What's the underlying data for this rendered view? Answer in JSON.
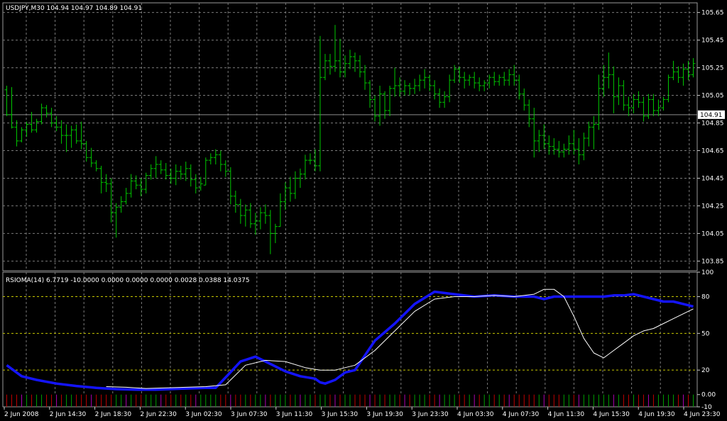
{
  "chart_data": [
    {
      "type": "ohlc",
      "title": "USDJPY,M30  104.94 104.97 104.89 104.91",
      "colors": {
        "bars": "#00c800",
        "background": "#000000",
        "grid": "#7a7a7a",
        "current_price_line": "#8c8c8c"
      },
      "ylim": [
        103.78,
        105.72
      ],
      "ytick_labels": [
        "105.65",
        "105.45",
        "105.25",
        "105.05",
        "104.85",
        "104.65",
        "104.45",
        "104.25",
        "104.05",
        "103.85"
      ],
      "current_price": 104.91,
      "current_price_label": "104.91",
      "grid": true,
      "bars": [
        [
          0,
          105.09,
          105.12,
          104.9,
          104.91
        ],
        [
          1,
          104.91,
          105.11,
          104.81,
          104.82
        ],
        [
          2,
          104.82,
          104.87,
          104.68,
          104.72
        ],
        [
          3,
          104.72,
          104.82,
          104.71,
          104.8
        ],
        [
          4,
          104.8,
          104.86,
          104.75,
          104.84
        ],
        [
          5,
          104.84,
          104.93,
          104.78,
          104.8
        ],
        [
          6,
          104.8,
          104.88,
          104.78,
          104.86
        ],
        [
          7,
          104.86,
          104.99,
          104.84,
          104.96
        ],
        [
          8,
          104.96,
          104.98,
          104.89,
          104.92
        ],
        [
          9,
          104.92,
          104.96,
          104.82,
          104.85
        ],
        [
          10,
          104.85,
          104.9,
          104.79,
          104.82
        ],
        [
          11,
          104.82,
          104.87,
          104.7,
          104.76
        ],
        [
          12,
          104.76,
          104.84,
          104.64,
          104.76
        ],
        [
          13,
          104.76,
          104.83,
          104.67,
          104.8
        ],
        [
          14,
          104.8,
          104.84,
          104.7,
          104.72
        ],
        [
          15,
          104.72,
          104.86,
          104.66,
          104.7
        ],
        [
          16,
          104.7,
          104.72,
          104.57,
          104.6
        ],
        [
          17,
          104.6,
          104.67,
          104.53,
          104.56
        ],
        [
          18,
          104.56,
          104.58,
          104.5,
          104.52
        ],
        [
          19,
          104.52,
          104.54,
          104.34,
          104.42
        ],
        [
          20,
          104.42,
          104.48,
          104.35,
          104.41
        ],
        [
          21,
          104.41,
          104.45,
          104.13,
          104.2
        ],
        [
          22,
          104.2,
          104.27,
          104.02,
          104.24
        ],
        [
          23,
          104.24,
          104.32,
          104.2,
          104.28
        ],
        [
          24,
          104.28,
          104.38,
          104.26,
          104.34
        ],
        [
          25,
          104.34,
          104.48,
          104.31,
          104.43
        ],
        [
          26,
          104.43,
          104.47,
          104.37,
          104.4
        ],
        [
          27,
          104.4,
          104.45,
          104.32,
          104.37
        ],
        [
          28,
          104.37,
          104.49,
          104.34,
          104.47
        ],
        [
          29,
          104.47,
          104.55,
          104.44,
          104.52
        ],
        [
          30,
          104.52,
          104.61,
          104.45,
          104.55
        ],
        [
          31,
          104.55,
          104.58,
          104.48,
          104.51
        ],
        [
          32,
          104.51,
          104.56,
          104.44,
          104.47
        ],
        [
          33,
          104.47,
          104.52,
          104.41,
          104.45
        ],
        [
          34,
          104.45,
          104.55,
          104.4,
          104.5
        ],
        [
          35,
          104.5,
          104.54,
          104.44,
          104.48
        ],
        [
          36,
          104.48,
          104.57,
          104.43,
          104.52
        ],
        [
          37,
          104.52,
          104.55,
          104.39,
          104.44
        ],
        [
          38,
          104.44,
          104.48,
          104.34,
          104.38
        ],
        [
          39,
          104.38,
          104.46,
          104.36,
          104.41
        ],
        [
          40,
          104.4,
          104.6,
          104.4,
          104.58
        ],
        [
          41,
          104.58,
          104.63,
          104.55,
          104.6
        ],
        [
          42,
          104.6,
          104.66,
          104.55,
          104.62
        ],
        [
          43,
          104.62,
          104.65,
          104.5,
          104.55
        ],
        [
          44,
          104.55,
          104.58,
          104.46,
          104.5
        ],
        [
          45,
          104.5,
          104.53,
          104.26,
          104.32
        ],
        [
          46,
          104.32,
          104.36,
          104.2,
          104.26
        ],
        [
          47,
          104.26,
          104.3,
          104.12,
          104.18
        ],
        [
          48,
          104.18,
          104.26,
          104.1,
          104.22
        ],
        [
          49,
          104.22,
          104.27,
          104.09,
          104.12
        ],
        [
          50,
          104.12,
          104.2,
          104.04,
          104.14
        ],
        [
          51,
          104.14,
          104.24,
          104.08,
          104.2
        ],
        [
          52,
          104.2,
          104.26,
          104.12,
          104.18
        ],
        [
          53,
          104.18,
          104.22,
          103.9,
          104.05
        ],
        [
          54,
          104.05,
          104.12,
          103.98,
          104.1
        ],
        [
          55,
          104.1,
          104.34,
          104.1,
          104.28
        ],
        [
          56,
          104.28,
          104.42,
          104.22,
          104.38
        ],
        [
          57,
          104.38,
          104.46,
          104.28,
          104.34
        ],
        [
          58,
          104.34,
          104.5,
          104.3,
          104.45
        ],
        [
          59,
          104.45,
          104.52,
          104.38,
          104.48
        ],
        [
          60,
          104.48,
          104.62,
          104.44,
          104.58
        ],
        [
          61,
          104.58,
          104.63,
          104.55,
          104.58
        ],
        [
          62,
          104.58,
          104.66,
          104.5,
          104.54
        ],
        [
          63,
          104.54,
          105.48,
          104.5,
          105.18
        ],
        [
          64,
          105.18,
          105.35,
          105.16,
          105.3
        ],
        [
          65,
          105.3,
          105.35,
          105.2,
          105.26
        ],
        [
          66,
          105.26,
          105.56,
          105.22,
          105.3
        ],
        [
          67,
          105.3,
          105.46,
          105.18,
          105.22
        ],
        [
          68,
          105.22,
          105.34,
          105.18,
          105.28
        ],
        [
          69,
          105.28,
          105.38,
          105.24,
          105.33
        ],
        [
          70,
          105.33,
          105.36,
          105.22,
          105.3
        ],
        [
          71,
          105.3,
          105.34,
          105.18,
          105.22
        ],
        [
          72,
          105.22,
          105.27,
          105.09,
          105.14
        ],
        [
          73,
          105.14,
          105.16,
          104.96,
          105.02
        ],
        [
          74,
          105.02,
          105.05,
          104.86,
          104.9
        ],
        [
          75,
          104.9,
          105.12,
          104.83,
          105.06
        ],
        [
          76,
          105.06,
          105.08,
          104.88,
          104.94
        ],
        [
          77,
          104.94,
          105.12,
          104.9,
          105.1
        ],
        [
          78,
          105.1,
          105.25,
          105.04,
          105.12
        ],
        [
          79,
          105.12,
          105.18,
          105.04,
          105.08
        ],
        [
          80,
          105.08,
          105.16,
          105.05,
          105.12
        ],
        [
          81,
          105.12,
          105.14,
          105.05,
          105.1
        ],
        [
          82,
          105.1,
          105.17,
          105.06,
          105.12
        ],
        [
          83,
          105.12,
          105.2,
          105.08,
          105.16
        ],
        [
          84,
          105.16,
          105.24,
          105.1,
          105.18
        ],
        [
          85,
          105.18,
          105.2,
          105.08,
          105.12
        ],
        [
          86,
          105.12,
          105.16,
          105.02,
          105.06
        ],
        [
          87,
          105.06,
          105.1,
          104.96,
          105.0
        ],
        [
          88,
          105.0,
          105.08,
          104.96,
          105.04
        ],
        [
          89,
          105.04,
          105.2,
          105.0,
          105.16
        ],
        [
          90,
          105.16,
          105.27,
          105.14,
          105.24
        ],
        [
          91,
          105.24,
          105.26,
          105.14,
          105.18
        ],
        [
          92,
          105.18,
          105.22,
          105.1,
          105.16
        ],
        [
          93,
          105.16,
          105.2,
          105.12,
          105.18
        ],
        [
          94,
          105.18,
          105.22,
          105.1,
          105.14
        ],
        [
          95,
          105.14,
          105.18,
          105.08,
          105.12
        ],
        [
          96,
          105.12,
          105.16,
          105.08,
          105.14
        ],
        [
          97,
          105.14,
          105.2,
          105.1,
          105.18
        ],
        [
          98,
          105.18,
          105.22,
          105.12,
          105.15
        ],
        [
          99,
          105.15,
          105.2,
          105.12,
          105.18
        ],
        [
          100,
          105.18,
          105.22,
          105.12,
          105.16
        ],
        [
          101,
          105.16,
          105.24,
          105.12,
          105.2
        ],
        [
          102,
          105.2,
          105.27,
          105.12,
          105.16
        ],
        [
          103,
          105.16,
          105.2,
          105.02,
          105.06
        ],
        [
          104,
          105.06,
          105.1,
          104.94,
          104.98
        ],
        [
          105,
          104.98,
          105.02,
          104.82,
          104.88
        ],
        [
          106,
          104.88,
          104.96,
          104.6,
          104.72
        ],
        [
          107,
          104.72,
          104.8,
          104.64,
          104.76
        ],
        [
          108,
          104.76,
          104.84,
          104.66,
          104.7
        ],
        [
          109,
          104.7,
          104.76,
          104.62,
          104.68
        ],
        [
          110,
          104.68,
          104.74,
          104.62,
          104.66
        ],
        [
          111,
          104.66,
          104.72,
          104.6,
          104.64
        ],
        [
          112,
          104.64,
          104.7,
          104.6,
          104.66
        ],
        [
          113,
          104.66,
          104.76,
          104.62,
          104.7
        ],
        [
          114,
          104.7,
          104.8,
          104.62,
          104.66
        ],
        [
          115,
          104.66,
          104.74,
          104.55,
          104.62
        ],
        [
          116,
          104.62,
          104.78,
          104.58,
          104.74
        ],
        [
          117,
          104.74,
          104.86,
          104.68,
          104.82
        ],
        [
          118,
          104.82,
          104.9,
          104.66,
          104.84
        ],
        [
          119,
          104.84,
          105.2,
          104.8,
          105.1
        ],
        [
          120,
          105.1,
          105.27,
          105.04,
          105.18
        ],
        [
          121,
          105.18,
          105.36,
          105.1,
          105.2
        ],
        [
          122,
          105.2,
          105.26,
          104.92,
          105.04
        ],
        [
          123,
          105.04,
          105.18,
          104.98,
          105.12
        ],
        [
          124,
          105.12,
          105.16,
          104.94,
          104.98
        ],
        [
          125,
          104.98,
          105.04,
          104.9,
          104.96
        ],
        [
          126,
          104.96,
          105.06,
          104.92,
          105.02
        ],
        [
          127,
          105.02,
          105.08,
          104.96,
          105.0
        ],
        [
          128,
          105.0,
          105.04,
          104.86,
          104.9
        ],
        [
          129,
          104.9,
          105.06,
          104.88,
          105.02
        ],
        [
          130,
          105.02,
          105.06,
          104.9,
          104.94
        ],
        [
          131,
          104.94,
          105.02,
          104.9,
          104.96
        ],
        [
          132,
          104.96,
          105.04,
          104.94,
          105.02
        ],
        [
          133,
          105.02,
          105.2,
          105.0,
          105.18
        ],
        [
          134,
          105.18,
          105.3,
          105.16,
          105.22
        ],
        [
          135,
          105.22,
          105.26,
          105.14,
          105.18
        ],
        [
          136,
          105.18,
          105.28,
          105.12,
          105.24
        ],
        [
          137,
          105.24,
          105.3,
          105.16,
          105.2
        ],
        [
          138,
          105.2,
          105.32,
          105.18,
          105.28
        ]
      ]
    },
    {
      "type": "line",
      "title": "RSIOMA(14) 6.7719 -10.0000 0.0000 0.0000 0.0000 0.0028 0.0388 14.0375",
      "ylim": [
        -10,
        100
      ],
      "ytick_labels": [
        "100",
        "80",
        "50",
        "20",
        "0.00",
        "-10"
      ],
      "levels": [
        80,
        50,
        20
      ],
      "grid": true,
      "series": [
        {
          "color": "#1414ff",
          "x": [
            0,
            3,
            6,
            10,
            14,
            18,
            22,
            26,
            30,
            36,
            40,
            42,
            44,
            47,
            50,
            53,
            56,
            59,
            62,
            63,
            64,
            66,
            68,
            70,
            74,
            78,
            82,
            86,
            90,
            94,
            98,
            102,
            104,
            106,
            108,
            110,
            112,
            114,
            116,
            118,
            120,
            122,
            124,
            126,
            128,
            130,
            132,
            134,
            136,
            138
          ],
          "y": [
            24,
            15,
            12,
            9,
            7,
            5.5,
            4.5,
            4,
            4,
            5,
            5.5,
            5.5,
            14,
            27,
            31,
            25,
            19,
            15,
            13,
            10,
            9,
            12,
            18,
            20,
            44,
            58,
            74,
            84,
            82,
            80,
            81,
            80,
            80,
            80,
            78,
            80,
            80,
            80,
            80,
            80,
            80,
            81,
            81,
            82,
            80,
            78,
            76,
            76,
            74,
            72
          ]
        },
        {
          "color": "#ffffff",
          "x": [
            0,
            5,
            10,
            15,
            20,
            24,
            28,
            32,
            36,
            40,
            44,
            48,
            52,
            56,
            60,
            63,
            66,
            70,
            74,
            78,
            82,
            86,
            90,
            94,
            98,
            102,
            106,
            108,
            110,
            112,
            114,
            116,
            118,
            120,
            122,
            124,
            126,
            128,
            130,
            132,
            134,
            136,
            138
          ],
          "y": [
            null,
            null,
            null,
            null,
            6.5,
            6,
            5,
            5.5,
            6,
            6.5,
            8,
            24,
            28,
            27,
            22,
            20,
            20,
            24,
            36,
            52,
            68,
            78,
            80,
            80,
            81,
            80,
            82,
            86,
            86,
            80,
            64,
            46,
            34,
            30,
            36,
            42,
            48,
            52,
            54,
            58,
            62,
            66,
            70
          ]
        }
      ]
    }
  ],
  "time_axis": {
    "labels": [
      "2 Jun 2008",
      "2 Jun 14:30",
      "2 Jun 18:30",
      "2 Jun 22:30",
      "3 Jun 02:30",
      "3 Jun 07:30",
      "3 Jun 11:30",
      "3 Jun 15:30",
      "3 Jun 19:30",
      "3 Jun 23:30",
      "4 Jun 03:30",
      "4 Jun 07:30",
      "4 Jun 11:30",
      "4 Jun 15:30",
      "4 Jun 19:30",
      "4 Jun 23:30"
    ]
  }
}
